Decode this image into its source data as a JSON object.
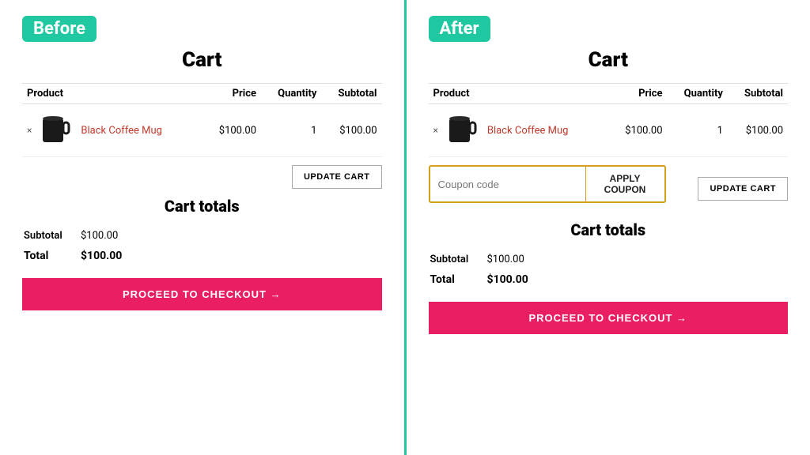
{
  "before": {
    "badge": "Before",
    "cart_title": "Cart",
    "table": {
      "headers": [
        "Product",
        "Price",
        "Quantity",
        "Subtotal"
      ],
      "row": {
        "remove": "×",
        "product_name": "Black Coffee Mug",
        "price": "$100.00",
        "quantity": "1",
        "subtotal": "$100.00"
      }
    },
    "update_cart_label": "UPDATE CART",
    "cart_totals_title": "Cart totals",
    "subtotal_label": "Subtotal",
    "subtotal_value": "$100.00",
    "total_label": "Total",
    "total_value": "$100.00",
    "checkout_label": "PROCEED TO CHECKOUT →"
  },
  "after": {
    "badge": "After",
    "cart_title": "Cart",
    "table": {
      "headers": [
        "Product",
        "Price",
        "Quantity",
        "Subtotal"
      ],
      "row": {
        "remove": "×",
        "product_name": "Black Coffee Mug",
        "price": "$100.00",
        "quantity": "1",
        "subtotal": "$100.00"
      }
    },
    "coupon_placeholder": "Coupon code",
    "apply_coupon_label": "APPLY COUPON",
    "update_cart_label": "UPDATE CART",
    "cart_totals_title": "Cart totals",
    "subtotal_label": "Subtotal",
    "subtotal_value": "$100.00",
    "total_label": "Total",
    "total_value": "$100.00",
    "checkout_label": "PROCEED TO CHECKOUT →"
  }
}
